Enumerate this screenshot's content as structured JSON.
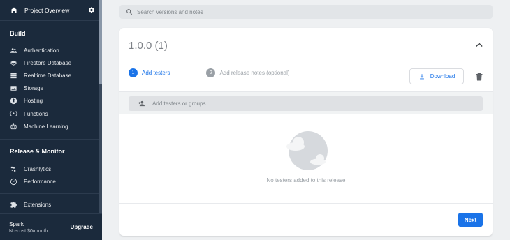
{
  "sidebar": {
    "project_title": "Project Overview",
    "sections": {
      "build": "Build",
      "release": "Release & Monitor"
    },
    "build_items": [
      {
        "label": "Authentication",
        "icon": "people-icon"
      },
      {
        "label": "Firestore Database",
        "icon": "firestore-icon"
      },
      {
        "label": "Realtime Database",
        "icon": "database-icon"
      },
      {
        "label": "Storage",
        "icon": "image-icon"
      },
      {
        "label": "Hosting",
        "icon": "hosting-icon"
      },
      {
        "label": "Functions",
        "icon": "functions-icon"
      },
      {
        "label": "Machine Learning",
        "icon": "robot-icon"
      }
    ],
    "release_items": [
      {
        "label": "Crashlytics",
        "icon": "crashlytics-icon"
      },
      {
        "label": "Performance",
        "icon": "speedometer-icon"
      }
    ],
    "extensions": {
      "label": "Extensions",
      "icon": "extensions-icon"
    },
    "plan": {
      "name": "Spark",
      "price": "No-cost $0/month",
      "upgrade_label": "Upgrade"
    }
  },
  "search": {
    "placeholder": "Search versions and notes"
  },
  "release_card": {
    "version": "1.0.0 (1)",
    "steps": [
      {
        "number": "1",
        "label": "Add testers",
        "state": "active"
      },
      {
        "number": "2",
        "label": "Add release notes (optional)",
        "state": "inactive"
      }
    ],
    "download_label": "Download",
    "testers_placeholder": "Add testers or groups",
    "empty_message": "No testers added to this release",
    "next_label": "Next"
  },
  "colors": {
    "sidebar_bg": "#1b2a3c",
    "accent": "#1a73e8",
    "page_bg": "#eef0f2"
  }
}
